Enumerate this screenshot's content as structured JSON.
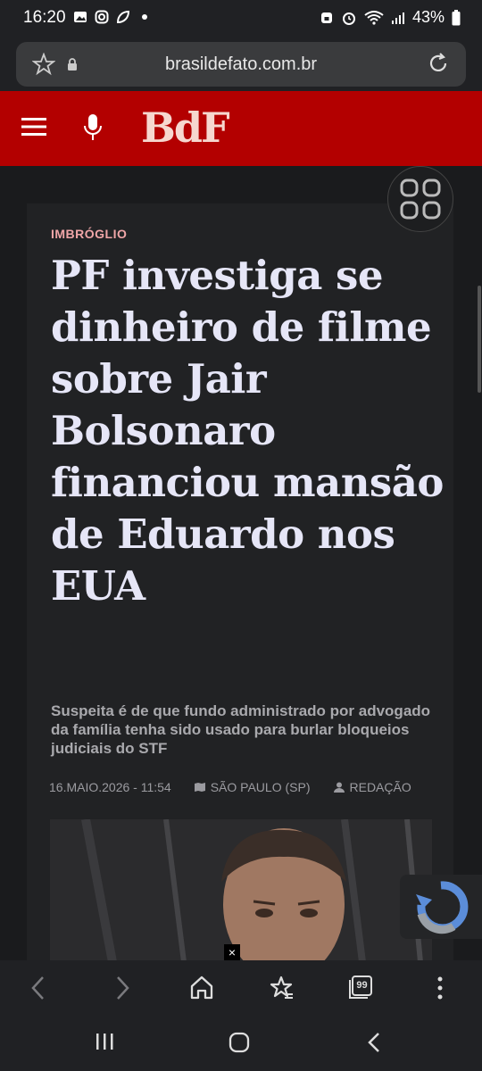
{
  "status_bar": {
    "time": "16:20",
    "battery": "43%"
  },
  "browser": {
    "url": "brasildefato.com.br"
  },
  "site": {
    "logo": "BdF"
  },
  "article": {
    "tag": "IMBRÓGLIO",
    "headline": "PF investiga se dinheiro de filme sobre Jair Bolsonaro financiou mansão de Eduardo nos EUA",
    "subtitle": "Suspeita é de que fundo administrado por advogado da família tenha sido usado para burlar bloqueios judiciais do STF",
    "date": "16.MAIO.2026 - 11:54",
    "location": "SÃO PAULO (SP)",
    "author": "REDAÇÃO"
  },
  "ad_close": "×",
  "tabs_count": "99",
  "colors": {
    "brand_red": "#b30000",
    "tag_pink": "#f0a6a8",
    "headline": "#e6e6f7"
  }
}
